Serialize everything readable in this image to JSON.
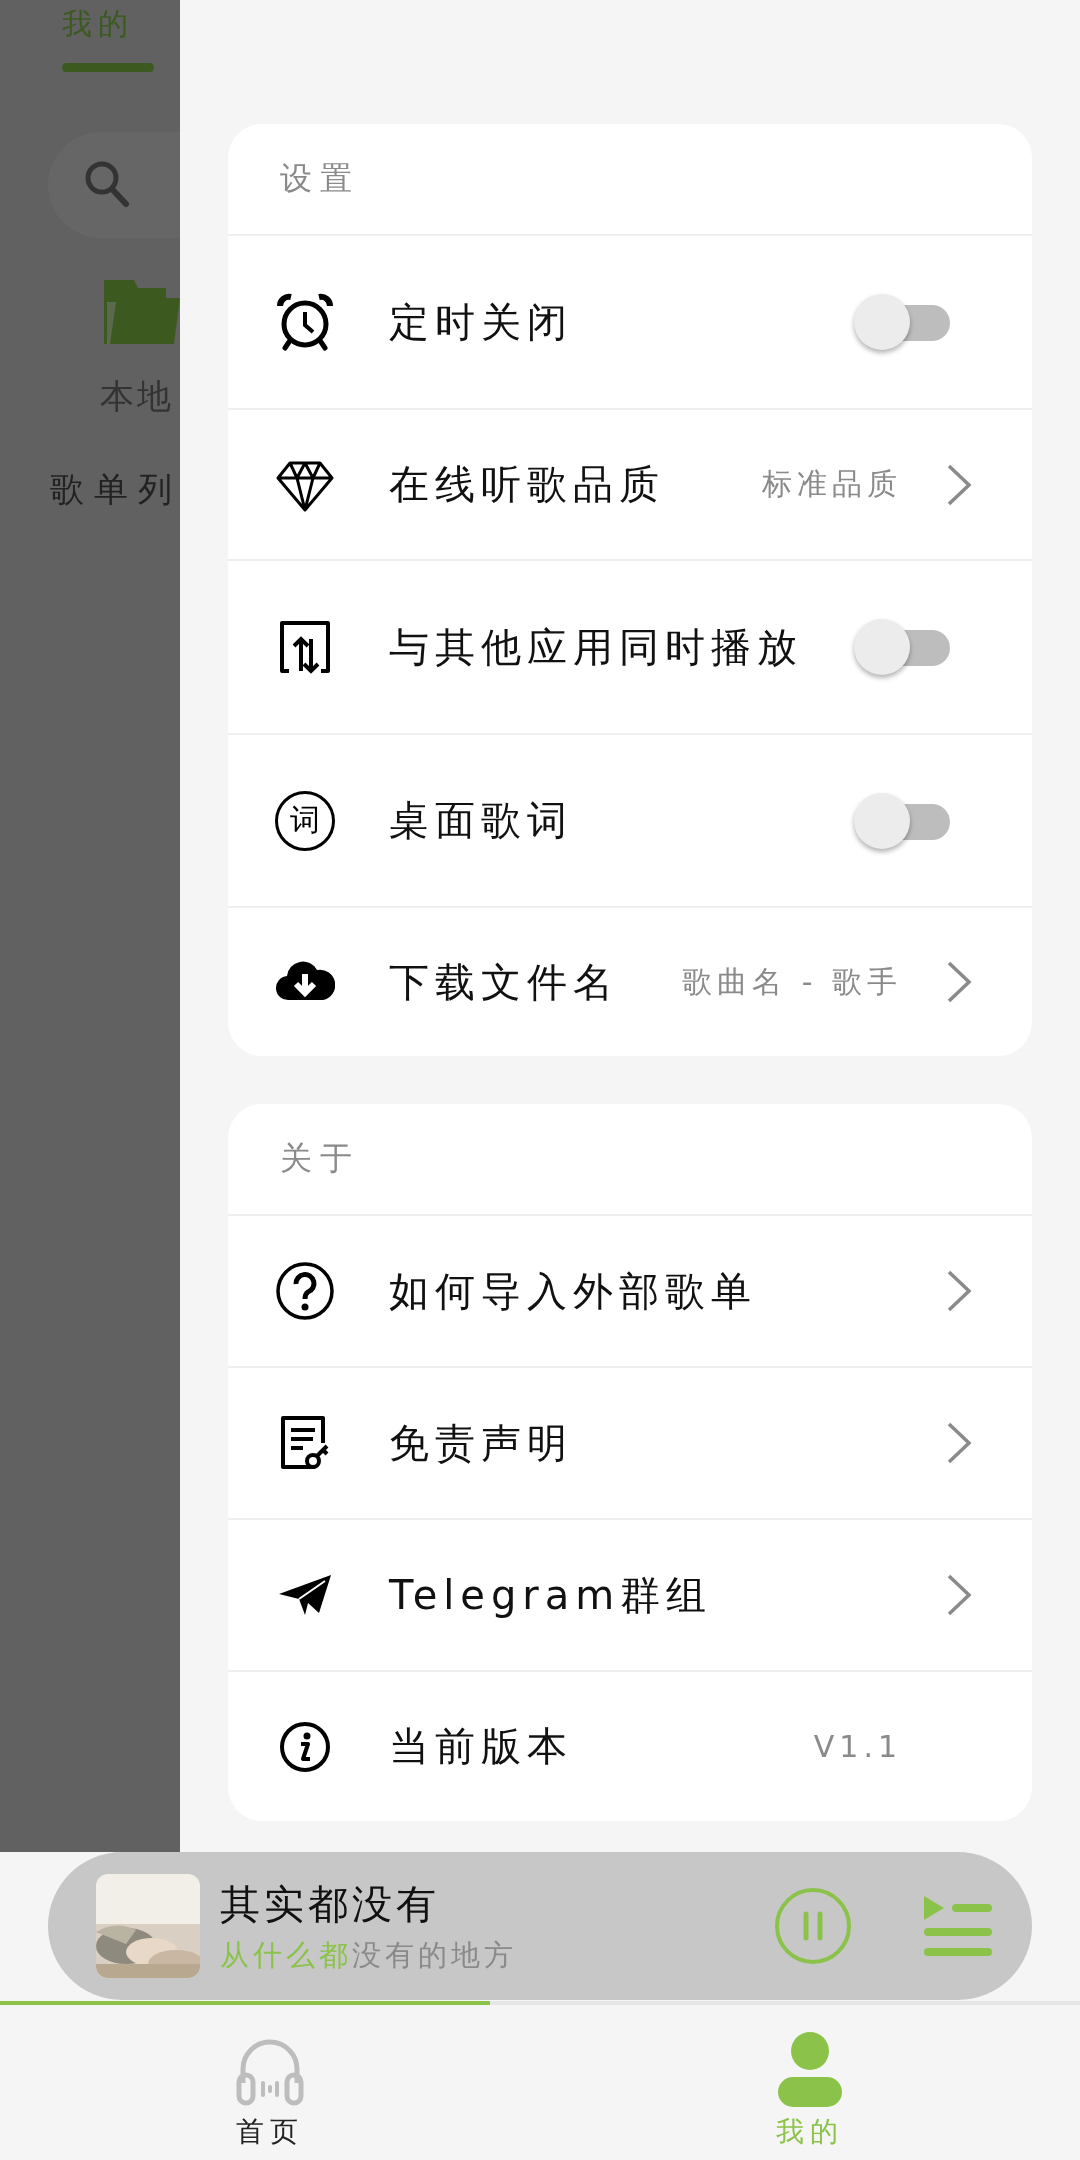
{
  "background_page": {
    "tab": {
      "label": "我的",
      "selected": true
    },
    "local_label": "本地",
    "playlist_heading": "歌单列"
  },
  "settings": {
    "title": "设置",
    "items": [
      {
        "kind": "toggle",
        "label": "定时关闭",
        "on": false
      },
      {
        "kind": "link",
        "label": "在线听歌品质",
        "value": "标准品质"
      },
      {
        "kind": "toggle",
        "label": "与其他应用同时播放",
        "on": false
      },
      {
        "kind": "toggle",
        "label": "桌面歌词",
        "on": false,
        "badge": "词"
      },
      {
        "kind": "link",
        "label": "下载文件名",
        "value": "歌曲名 - 歌手"
      }
    ]
  },
  "about": {
    "title": "关于",
    "items": [
      {
        "kind": "link",
        "label": "如何导入外部歌单"
      },
      {
        "kind": "link",
        "label": "免责声明"
      },
      {
        "kind": "link",
        "label": "Telegram群组"
      },
      {
        "kind": "info",
        "label": "当前版本",
        "value": "V1.1"
      }
    ]
  },
  "player": {
    "title": "其实都没有",
    "lyric_sung": "从什么都",
    "lyric_rest": "没有的地方",
    "playing": true,
    "level": 0.454
  },
  "nav": [
    {
      "label": "首页",
      "selected": false
    },
    {
      "label": "我的",
      "selected": true
    }
  ]
}
